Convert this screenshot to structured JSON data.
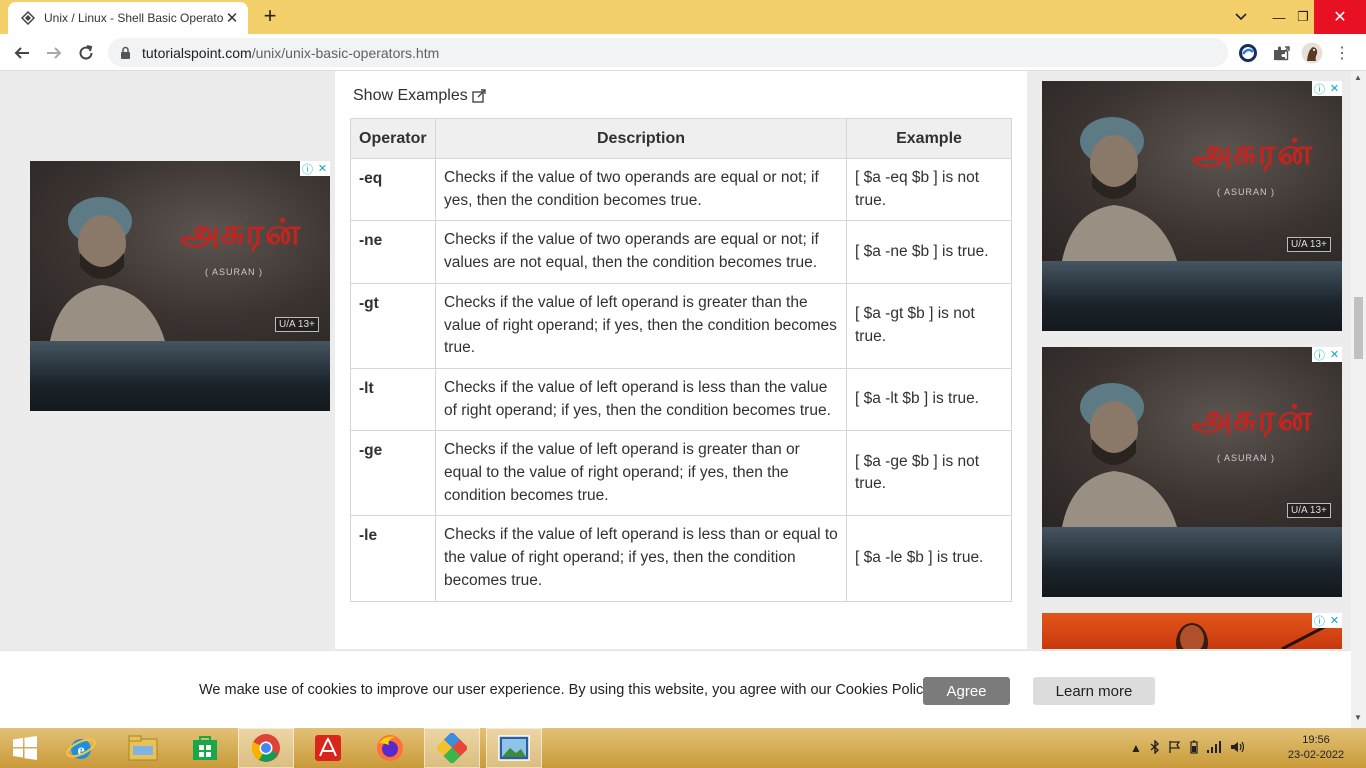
{
  "browser": {
    "tab_title": "Unix / Linux - Shell Basic Operato",
    "url_host": "tutorialspoint.com",
    "url_path": "/unix/unix-basic-operators.htm"
  },
  "page": {
    "show_examples": "Show Examples",
    "table": {
      "headers": [
        "Operator",
        "Description",
        "Example"
      ],
      "rows": [
        {
          "op": "-eq",
          "desc": "Checks if the value of two operands are equal or not; if yes, then the condition becomes true.",
          "example": "[ $a -eq $b ] is not true."
        },
        {
          "op": "-ne",
          "desc": "Checks if the value of two operands are equal or not; if values are not equal, then the condition becomes true.",
          "example": "[ $a -ne $b ] is true."
        },
        {
          "op": "-gt",
          "desc": "Checks if the value of left operand is greater than the value of right operand; if yes, then the condition becomes true.",
          "example": "[ $a -gt $b ] is not true."
        },
        {
          "op": "-lt",
          "desc": "Checks if the value of left operand is less than the value of right operand; if yes, then the condition becomes true.",
          "example": "[ $a -lt $b ] is true."
        },
        {
          "op": "-ge",
          "desc": "Checks if the value of left operand is greater than or equal to the value of right operand; if yes, then the condition becomes true.",
          "example": "[ $a -ge $b ] is not true."
        },
        {
          "op": "-le",
          "desc": "Checks if the value of left operand is less than or equal to the value of right operand; if yes, then the condition becomes true.",
          "example": "[ $a -le $b ] is true."
        }
      ]
    }
  },
  "ads": {
    "poster_title": "அசுரன்",
    "poster_subtitle": "( ASURAN )",
    "rating": "U/A 13+"
  },
  "cookie": {
    "text": "We make use of cookies to improve our user experience. By using this website, you agree with our Cookies Policy.",
    "agree": "Agree",
    "learn_more": "Learn more"
  },
  "taskbar": {
    "time": "19:56",
    "date": "23-02-2022"
  },
  "colors": {
    "tabstrip": "#f4d06a",
    "close_red": "#e81123",
    "link_blue": "#1a73e8",
    "poster_red": "#c2241f"
  }
}
